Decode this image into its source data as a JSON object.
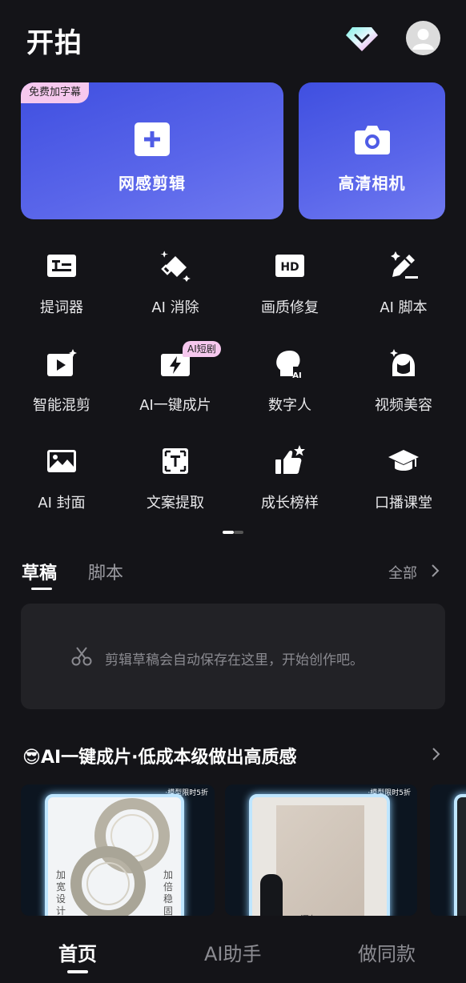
{
  "app": {
    "title": "开拍"
  },
  "header": {
    "vip_icon": "diamond-icon",
    "avatar_icon": "user-avatar-icon"
  },
  "cards": [
    {
      "label": "网感剪辑",
      "badge": "免费加字幕",
      "icon": "plus-icon"
    },
    {
      "label": "高清相机",
      "icon": "camera-icon"
    }
  ],
  "tools": [
    {
      "label": "提词器",
      "icon": "teleprompter-icon"
    },
    {
      "label": "AI 消除",
      "icon": "eraser-icon"
    },
    {
      "label": "画质修复",
      "icon": "hd-icon"
    },
    {
      "label": "AI 脚本",
      "icon": "pen-sparkle-icon"
    },
    {
      "label": "智能混剪",
      "icon": "video-play-icon"
    },
    {
      "label": "AI一键成片",
      "icon": "lightning-icon",
      "badge": "AI短剧"
    },
    {
      "label": "数字人",
      "icon": "digital-human-icon"
    },
    {
      "label": "视频美容",
      "icon": "face-beauty-icon"
    },
    {
      "label": "AI 封面",
      "icon": "image-icon"
    },
    {
      "label": "文案提取",
      "icon": "text-extract-icon"
    },
    {
      "label": "成长榜样",
      "icon": "thumbs-up-icon"
    },
    {
      "label": "口播课堂",
      "icon": "graduation-cap-icon"
    }
  ],
  "tabs": {
    "drafts": "草稿",
    "scripts": "脚本",
    "see_all": "全部"
  },
  "drafts": {
    "empty_hint": "剪辑草稿会自动保存在这里，开始创作吧。"
  },
  "section": {
    "emoji": "😎",
    "title": "AI一键成片·低成本级做出高质感"
  },
  "thumbnails": [
    {
      "tag": "·模型限时5折",
      "left_text": "加宽设计",
      "right_text": "加倍稳固"
    },
    {
      "tag": "·模型限时5折",
      "caption": "深灰"
    },
    {
      "tag": ""
    }
  ],
  "bottom_nav": {
    "home": "首页",
    "ai_assistant": "AI助手",
    "same_style": "做同款"
  },
  "colors": {
    "accent": "#4f5ce6",
    "badge_pink": "#f6c8ee",
    "background": "#141418"
  }
}
